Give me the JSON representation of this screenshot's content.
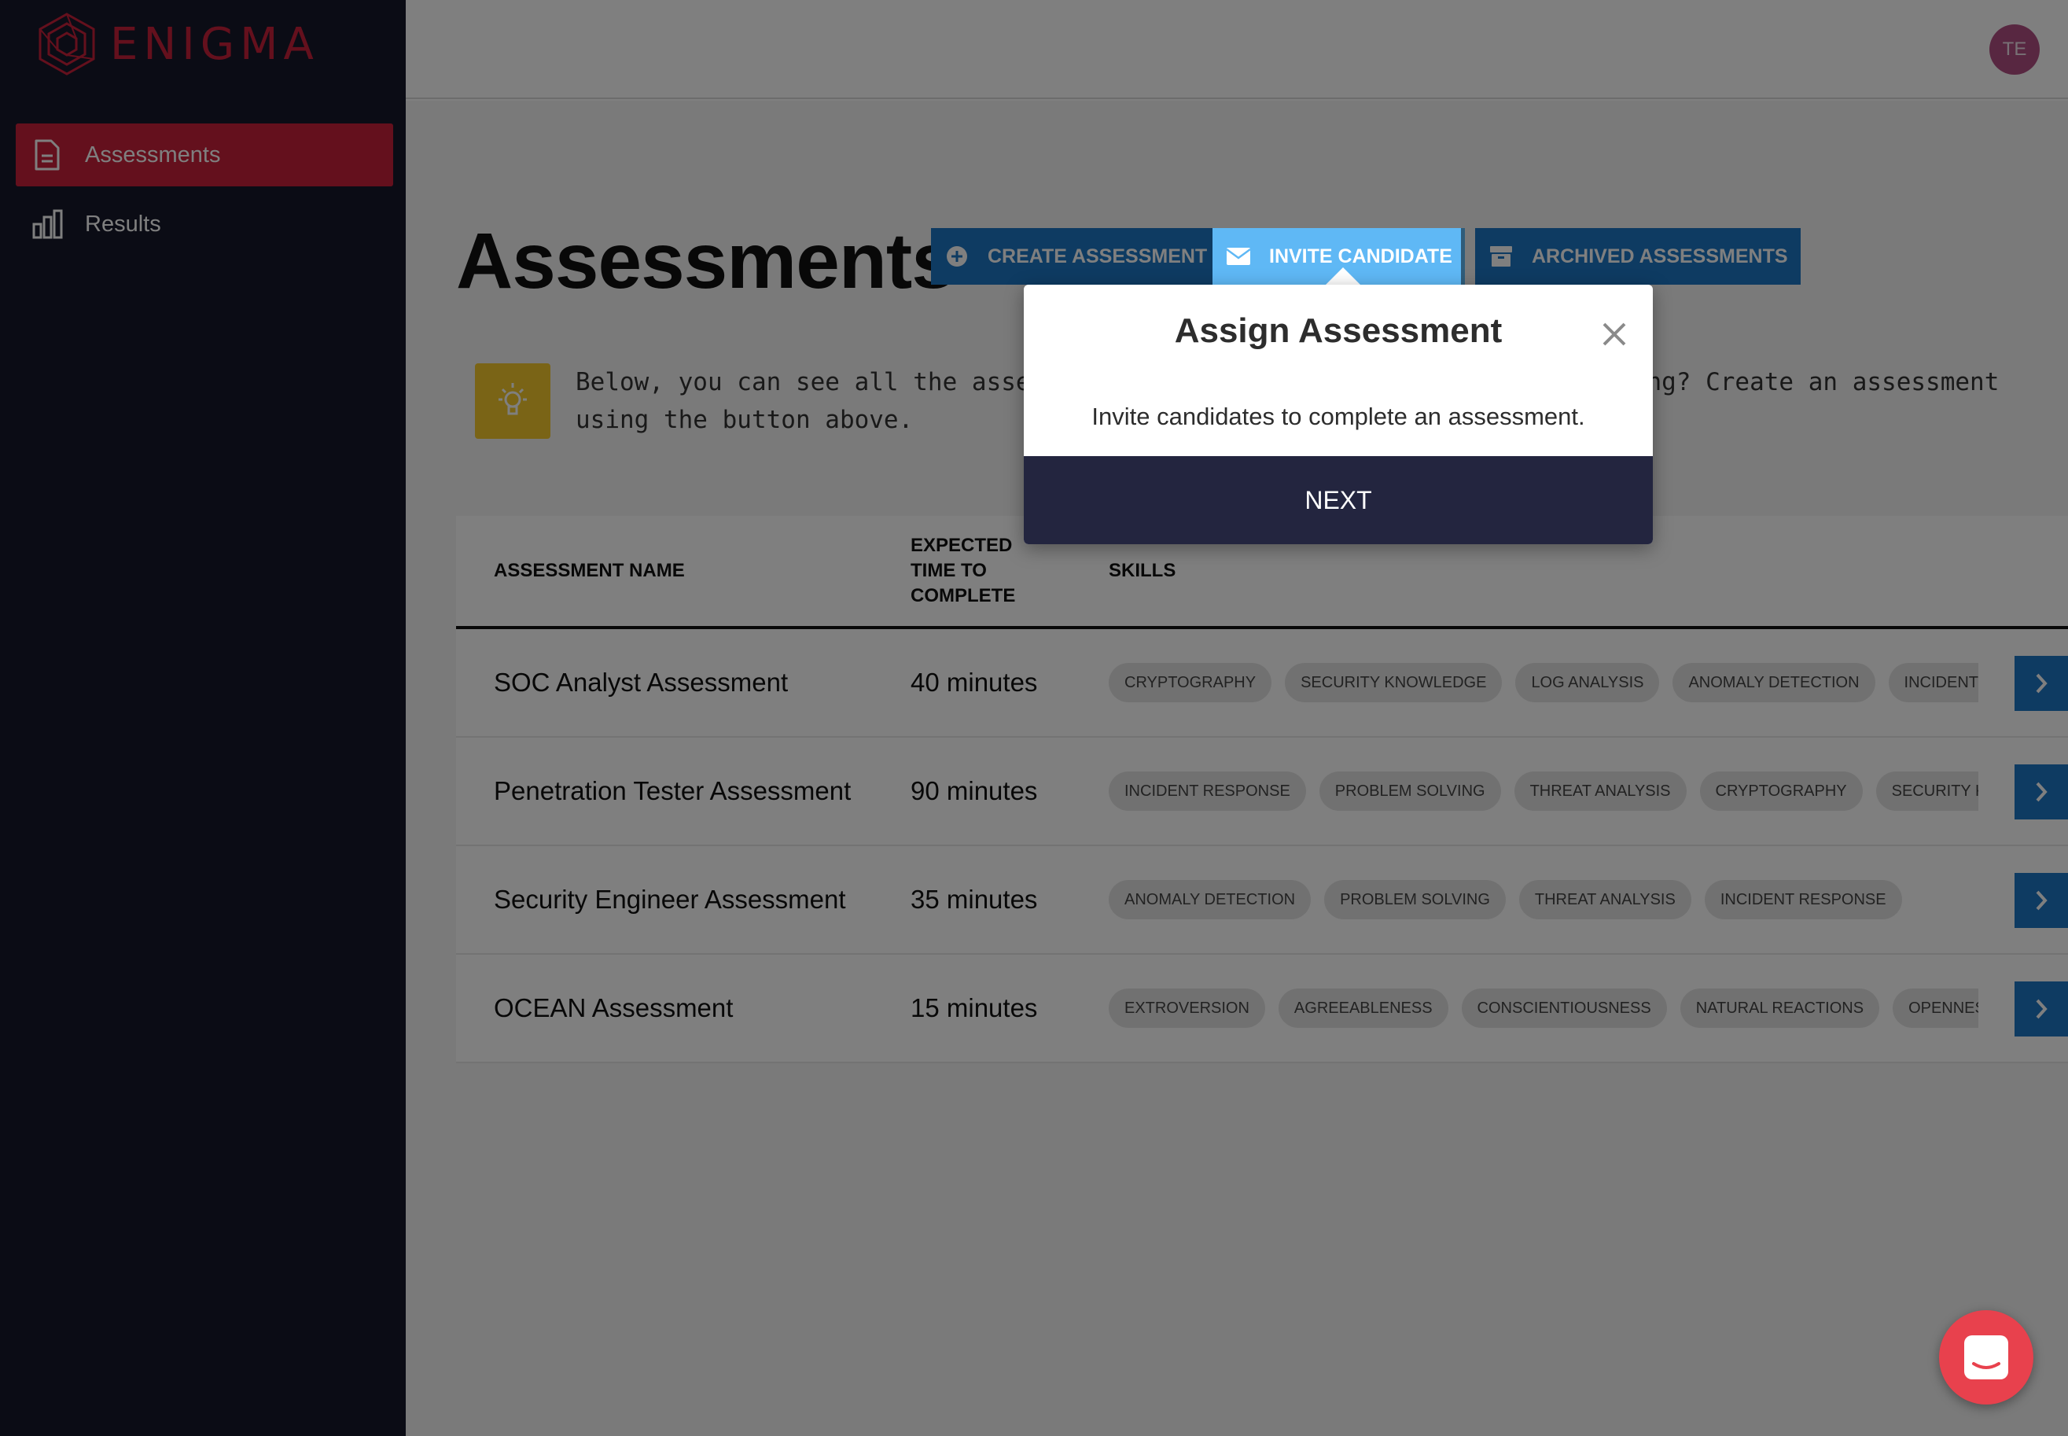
{
  "brand": {
    "name": "ENIGMA"
  },
  "sidebar": {
    "items": [
      {
        "label": "Assessments",
        "icon": "document-icon",
        "active": true
      },
      {
        "label": "Results",
        "icon": "bar-chart-icon",
        "active": false
      }
    ]
  },
  "header": {
    "avatar_initials": "TE"
  },
  "main": {
    "title": "Assessments",
    "buttons": {
      "create": "CREATE ASSESSMENT",
      "invite": "INVITE CANDIDATE",
      "archived": "ARCHIVED ASSESSMENTS"
    },
    "tip": "Below, you can see all the assessments you have created. Don't see anything? Create an assessment using the button above."
  },
  "table": {
    "headers": {
      "name": "ASSESSMENT NAME",
      "time": "EXPECTED TIME TO COMPLETE",
      "skills": "SKILLS"
    },
    "rows": [
      {
        "name": "SOC Analyst Assessment",
        "time": "40 minutes",
        "skills": [
          "CRYPTOGRAPHY",
          "SECURITY KNOWLEDGE",
          "LOG ANALYSIS",
          "ANOMALY DETECTION",
          "INCIDENT RESPONSE"
        ]
      },
      {
        "name": "Penetration Tester Assessment",
        "time": "90 minutes",
        "skills": [
          "INCIDENT RESPONSE",
          "PROBLEM SOLVING",
          "THREAT ANALYSIS",
          "CRYPTOGRAPHY",
          "SECURITY KNOWLEDGE"
        ]
      },
      {
        "name": "Security Engineer Assessment",
        "time": "35 minutes",
        "skills": [
          "ANOMALY DETECTION",
          "PROBLEM SOLVING",
          "THREAT ANALYSIS",
          "INCIDENT RESPONSE"
        ]
      },
      {
        "name": "OCEAN Assessment",
        "time": "15 minutes",
        "skills": [
          "EXTROVERSION",
          "AGREEABLENESS",
          "CONSCIENTIOUSNESS",
          "NATURAL REACTIONS",
          "OPENNESS TO EXPERIENCE"
        ]
      }
    ]
  },
  "popover": {
    "title": "Assign Assessment",
    "description": "Invite candidates to complete an assessment.",
    "next_label": "NEXT"
  },
  "colors": {
    "sidebar_bg": "#16182a",
    "brand_red": "#c8203b",
    "button_blue": "#1d77c4",
    "highlight_blue": "#5fb8f5",
    "tip_yellow": "#f5c82c",
    "popover_next_bg": "#23253f",
    "chat_red": "#e8414d"
  }
}
